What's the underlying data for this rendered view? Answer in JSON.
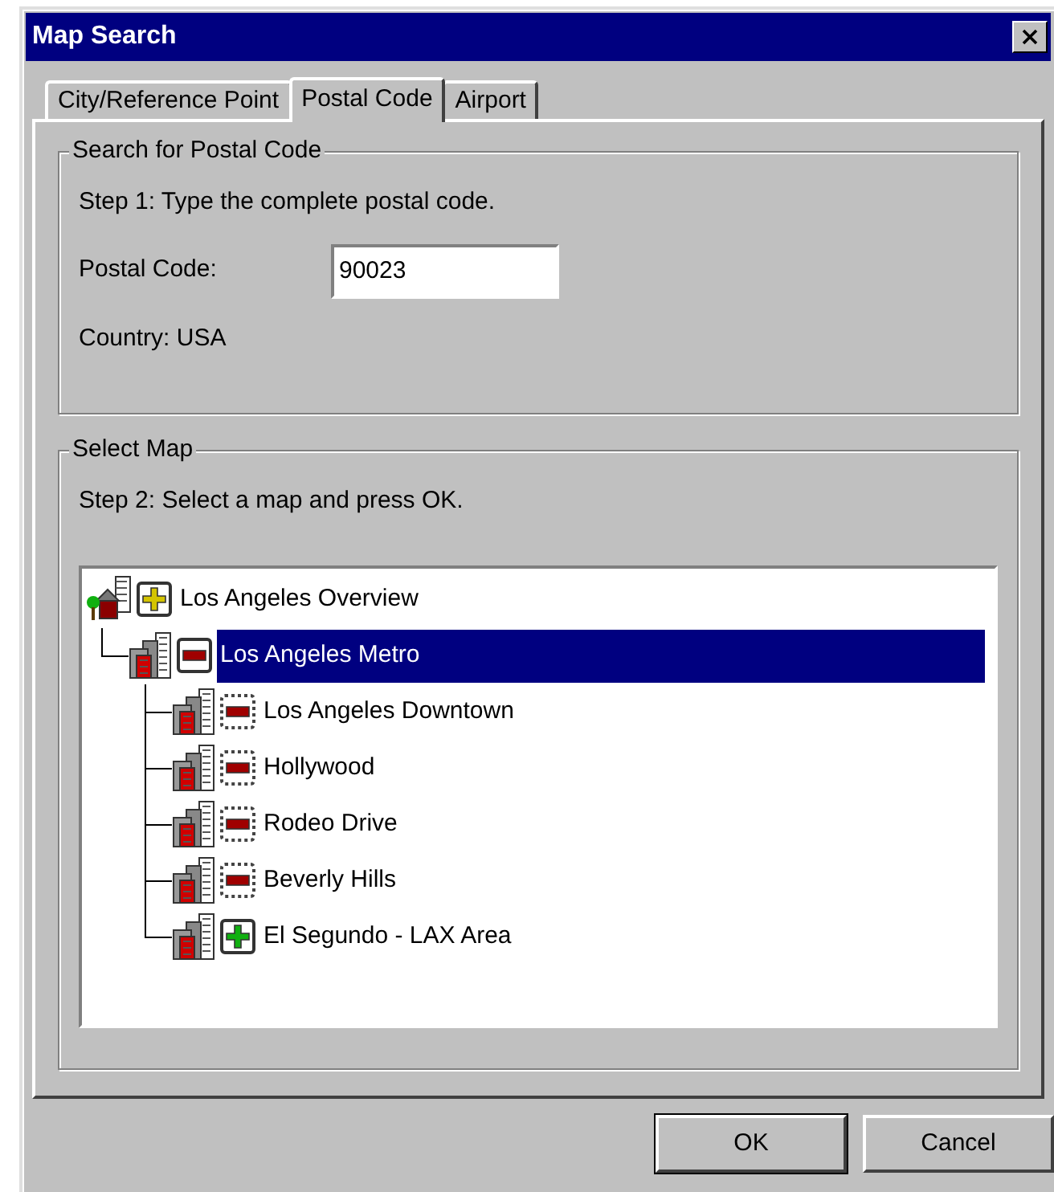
{
  "window": {
    "title": "Map Search"
  },
  "tabs": [
    {
      "label": "City/Reference Point",
      "selected": false
    },
    {
      "label": "Postal Code",
      "selected": true
    },
    {
      "label": "Airport",
      "selected": false
    }
  ],
  "search_group": {
    "title": "Search for Postal Code",
    "step": "Step 1:  Type the complete postal code.",
    "postal_code": {
      "label": "Postal Code:",
      "value": "90023"
    },
    "country": "Country:  USA"
  },
  "map_group": {
    "title": "Select Map",
    "step": "Step 2:  Select a map and press OK.",
    "tree": [
      {
        "label": "Los Angeles Overview",
        "kind": "overview",
        "badge": {
          "kind": "plus",
          "color": "#d4c400",
          "dotted": false
        },
        "selected": false,
        "children": [
          {
            "label": "Los Angeles Metro",
            "kind": "city",
            "badge": {
              "kind": "minus",
              "color": "#a00000",
              "dotted": false
            },
            "selected": true,
            "children": [
              {
                "label": "Los Angeles Downtown",
                "kind": "city",
                "badge": {
                  "kind": "minus",
                  "color": "#a00000",
                  "dotted": true
                },
                "selected": false
              },
              {
                "label": "Hollywood",
                "kind": "city",
                "badge": {
                  "kind": "minus",
                  "color": "#a00000",
                  "dotted": true
                },
                "selected": false
              },
              {
                "label": "Rodeo Drive",
                "kind": "city",
                "badge": {
                  "kind": "minus",
                  "color": "#a00000",
                  "dotted": true
                },
                "selected": false
              },
              {
                "label": "Beverly Hills",
                "kind": "city",
                "badge": {
                  "kind": "minus",
                  "color": "#a00000",
                  "dotted": true
                },
                "selected": false
              },
              {
                "label": "El Segundo - LAX Area",
                "kind": "city",
                "badge": {
                  "kind": "plus",
                  "color": "#10b010",
                  "dotted": false
                },
                "selected": false
              }
            ]
          }
        ]
      }
    ]
  },
  "buttons": [
    {
      "label": "OK",
      "default": true
    },
    {
      "label": "Cancel",
      "default": false
    }
  ]
}
